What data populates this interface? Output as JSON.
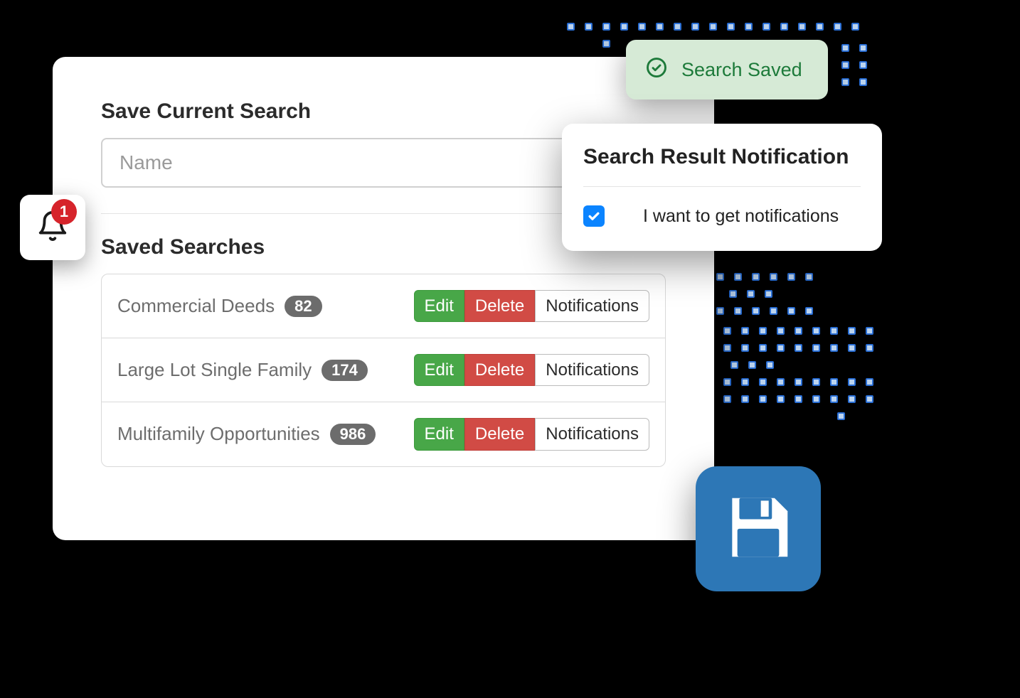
{
  "colors": {
    "edit": "#48a748",
    "delete": "#d14b45",
    "accent_blue": "#2d77b6",
    "toast_green": "#1d7a3a",
    "badge_red": "#d6242b",
    "checkbox_blue": "#0b84ff"
  },
  "bell": {
    "badge_count": "1"
  },
  "toast": {
    "label": "Search Saved"
  },
  "save_panel": {
    "title": "Save Current Search",
    "name_placeholder": "Name"
  },
  "saved_list": {
    "title": "Saved Searches",
    "edit_label": "Edit",
    "delete_label": "Delete",
    "notifications_label": "Notifications",
    "rows": [
      {
        "name": "Commercial Deeds",
        "count": "82"
      },
      {
        "name": "Large Lot Single Family",
        "count": "174"
      },
      {
        "name": "Multifamily Opportunities",
        "count": "986"
      }
    ]
  },
  "notification_panel": {
    "title": "Search Result Notification",
    "checkbox_checked": true,
    "checkbox_label": "I want to get notifications"
  }
}
